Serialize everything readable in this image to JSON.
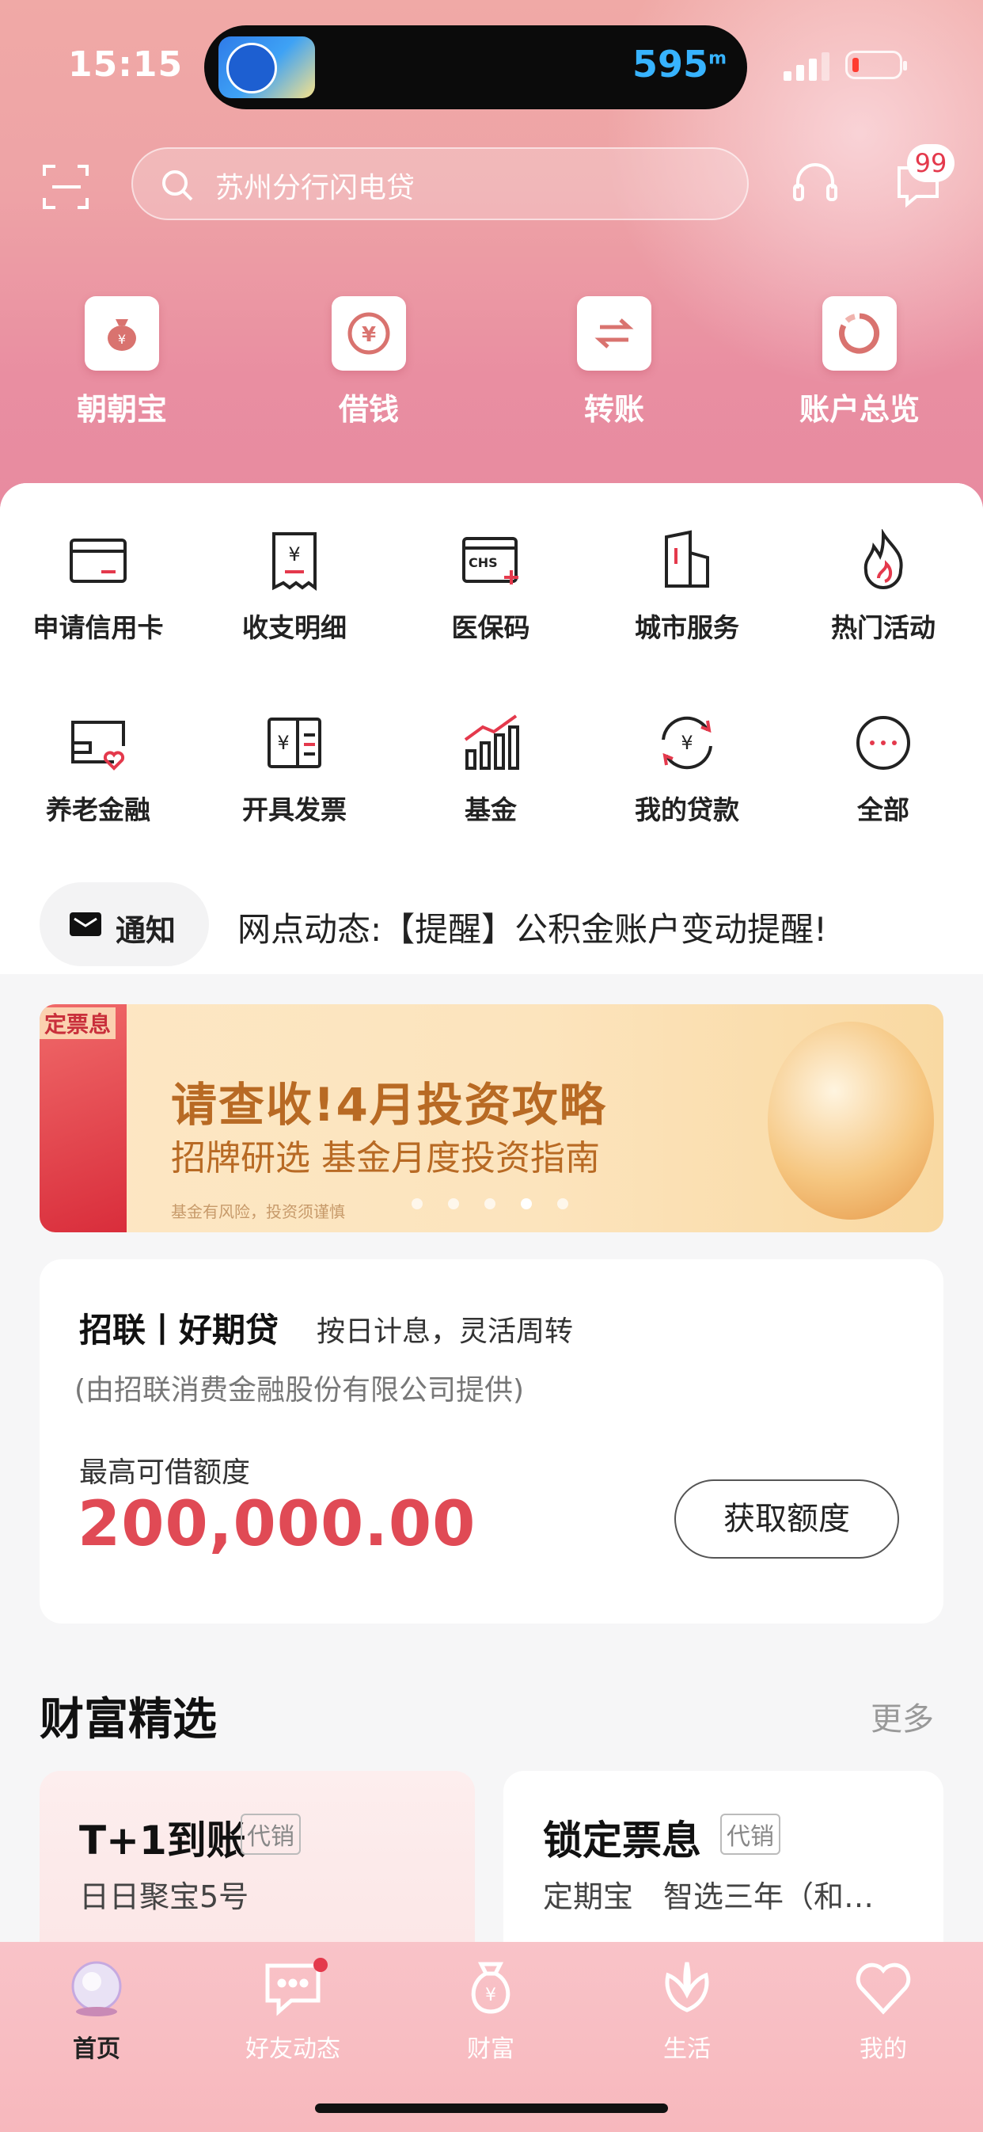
{
  "status": {
    "time": "15:15",
    "distance": "595",
    "distance_unit": "m"
  },
  "header": {
    "search_placeholder": "苏州分行闪电贷",
    "message_badge": "99"
  },
  "quick_actions": [
    {
      "label": "朝朝宝",
      "icon": "money-bag-icon"
    },
    {
      "label": "借钱",
      "icon": "yuan-coin-icon"
    },
    {
      "label": "转账",
      "icon": "transfer-arrows-icon"
    },
    {
      "label": "账户总览",
      "icon": "ring-chart-icon"
    }
  ],
  "services": [
    {
      "label": "申请信用卡",
      "icon": "credit-card-icon"
    },
    {
      "label": "收支明细",
      "icon": "receipt-icon"
    },
    {
      "label": "医保码",
      "icon": "medical-insurance-icon"
    },
    {
      "label": "城市服务",
      "icon": "city-building-icon"
    },
    {
      "label": "热门活动",
      "icon": "flame-icon"
    },
    {
      "label": "养老金融",
      "icon": "pension-card-icon"
    },
    {
      "label": "开具发票",
      "icon": "invoice-icon"
    },
    {
      "label": "基金",
      "icon": "bar-chart-icon"
    },
    {
      "label": "我的贷款",
      "icon": "loan-cycle-icon"
    },
    {
      "label": "全部",
      "icon": "more-dots-icon"
    }
  ],
  "notice": {
    "pill_label": "通知",
    "text": "网点动态:【提醒】公积金账户变动提醒!"
  },
  "banner": {
    "side_tag": "定票息",
    "headline": "请查收!4月投资攻略",
    "subline": "招牌研选 基金月度投资指南",
    "disclaimer": "基金有风险，投资须谨慎"
  },
  "loan": {
    "brand": "招联丨好期贷",
    "slogan": "按日计息，灵活周转",
    "provider": "(由招联消费金融股份有限公司提供)",
    "limit_label": "最高可借额度",
    "amount": "200,000.00",
    "button": "获取额度"
  },
  "wealth": {
    "title": "财富精选",
    "more": "更多",
    "products": [
      {
        "name": "T+1到账",
        "tag": "代销",
        "sub": "日日聚宝5号"
      },
      {
        "name": "锁定票息",
        "tag": "代销",
        "sub": "定期宝　智选三年（和…"
      }
    ]
  },
  "tabbar": [
    {
      "label": "首页",
      "active": true
    },
    {
      "label": "好友动态"
    },
    {
      "label": "财富"
    },
    {
      "label": "生活"
    },
    {
      "label": "我的"
    }
  ],
  "colors": {
    "accent_red": "#e04a55",
    "hero_pink": "#ee9fa6",
    "banner_gold": "#b86a24"
  }
}
